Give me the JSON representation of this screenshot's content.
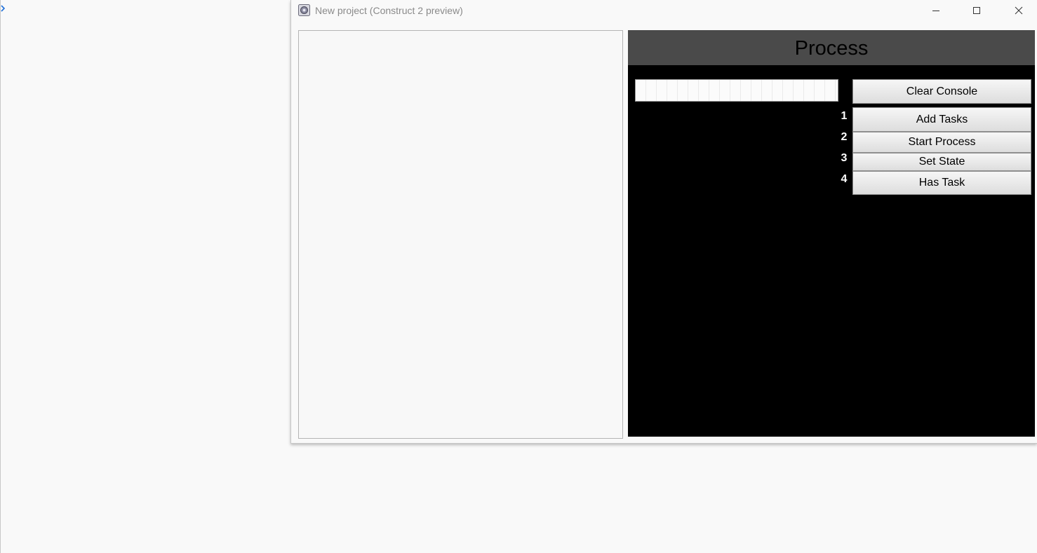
{
  "window": {
    "title": "New project (Construct 2 preview)"
  },
  "process_panel": {
    "title": "Process",
    "console_input": {
      "value": "",
      "placeholder": ""
    },
    "clear_console_label": "Clear Console",
    "steps": [
      {
        "number": "1",
        "label": "Add Tasks"
      },
      {
        "number": "2",
        "label": "Start Process"
      },
      {
        "number": "3",
        "label": "Set State"
      },
      {
        "number": "4",
        "label": "Has Task"
      }
    ]
  },
  "colors": {
    "header_bg": "#4a4a4a",
    "panel_bg": "#000000",
    "window_bg": "#f9f9f9",
    "step_number": "#ffffff"
  },
  "icons": {
    "left_edge": "chevron-right-icon",
    "app": "construct-app-icon",
    "minimize": "minimize-icon",
    "maximize": "maximize-icon",
    "close": "close-icon"
  }
}
